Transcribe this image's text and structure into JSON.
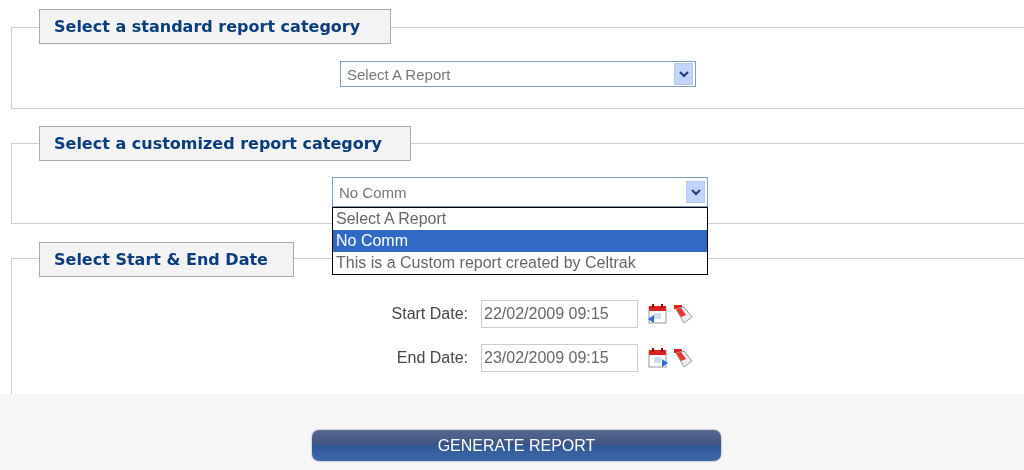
{
  "sections": [
    {
      "kind": "select",
      "legend": "Select a standard report category",
      "select": {
        "value": "Select A Report"
      }
    },
    {
      "kind": "select",
      "legend": "Select a customized report category",
      "select": {
        "value": "No Comm",
        "options": [
          {
            "label": "Select A Report",
            "selected": false
          },
          {
            "label": "No Comm",
            "selected": true
          },
          {
            "label": "This is a Custom report created by Celtrak",
            "selected": false
          }
        ]
      }
    },
    {
      "kind": "dates",
      "legend": "Select Start & End Date",
      "dates": [
        {
          "label": "Start Date:",
          "value": "22/02/2009 09:15",
          "kind": "back"
        },
        {
          "label": "End Date:",
          "value": "23/02/2009 09:15",
          "kind": "forward"
        }
      ]
    }
  ],
  "button": "GENERATE REPORT"
}
